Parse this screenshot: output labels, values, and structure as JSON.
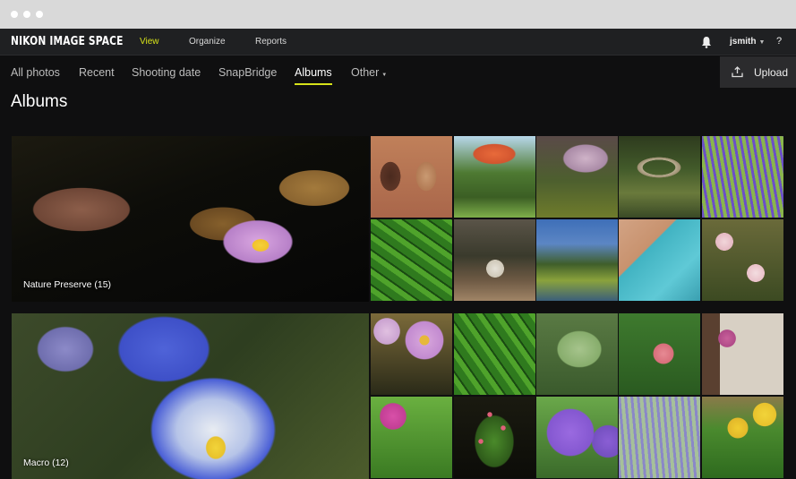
{
  "window": {
    "controls": [
      "close",
      "minimize",
      "maximize"
    ]
  },
  "topbar": {
    "brand": "NIKON IMAGE SPACE",
    "nav": [
      {
        "label": "View",
        "active": true
      },
      {
        "label": "Organize",
        "active": false
      },
      {
        "label": "Reports",
        "active": false
      }
    ],
    "notifications_icon": "bell-icon",
    "user": "jsmith",
    "help": "?"
  },
  "subnav": {
    "items": [
      {
        "label": "All photos",
        "active": false
      },
      {
        "label": "Recent",
        "active": false
      },
      {
        "label": "Shooting date",
        "active": false
      },
      {
        "label": "SnapBridge",
        "active": false
      },
      {
        "label": "Albums",
        "active": true
      },
      {
        "label": "Other",
        "active": false,
        "dropdown": true
      }
    ],
    "upload_label": "Upload",
    "accent": "#d6e21a"
  },
  "page": {
    "title": "Albums"
  },
  "albums": [
    {
      "name": "Nature Preserve (15)",
      "cover": "water lily with lily pads",
      "thumbnails": [
        "carved wooden window",
        "flowering tree",
        "blossoming tree over pond",
        "stone bridge over stream",
        "lavender field",
        "monstera leaf",
        "tree-lined path",
        "garden pond",
        "turquoise bench",
        "pink blossoms"
      ]
    },
    {
      "name": "Macro (12)",
      "cover": "blue and yellow pansy",
      "thumbnails": [
        "pink asters with gnome",
        "monstera leaf",
        "frosted leaf",
        "pink rose buds",
        "pink orchid by house",
        "pink flower with leaves",
        "red berries on branch",
        "purple allium",
        "lavender close-up",
        "dandelions in grass"
      ]
    }
  ]
}
